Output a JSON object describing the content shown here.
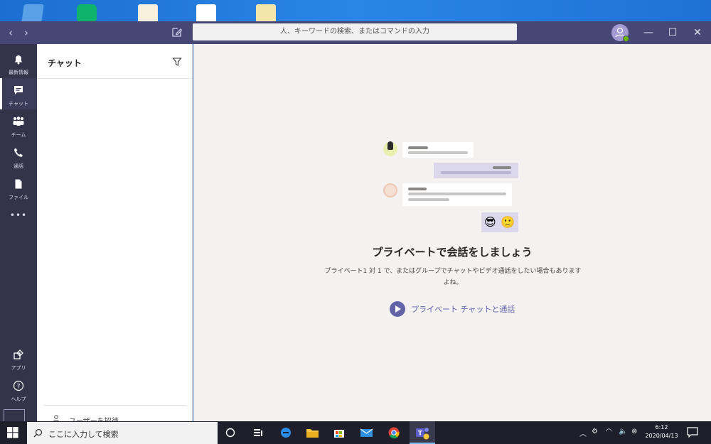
{
  "window": {
    "search_placeholder": "人、キーワードの検索、またはコマンドの入力",
    "controls": {
      "minimize": "—",
      "maximize": "☐",
      "close": "✕"
    }
  },
  "appbar": {
    "items": [
      {
        "label": "最新情報",
        "icon": "bell-icon"
      },
      {
        "label": "チャット",
        "icon": "chat-icon",
        "active": true
      },
      {
        "label": "チーム",
        "icon": "teams-icon"
      },
      {
        "label": "通話",
        "icon": "phone-icon"
      },
      {
        "label": "ファイル",
        "icon": "file-icon"
      },
      {
        "label": "•••",
        "icon": "more-icon"
      }
    ],
    "bottom": [
      {
        "label": "アプリ",
        "icon": "apps-icon"
      },
      {
        "label": "ヘルプ",
        "icon": "help-icon"
      }
    ]
  },
  "chat": {
    "title": "チャット",
    "footer_invite": "ユーザーを招待"
  },
  "main": {
    "headline": "プライベートで会話をしましょう",
    "subtext": "プライベート1 対 1 で、またはグループでチャットやビデオ通話をしたい場合もありますよね。",
    "cta": "プライベート チャットと通話",
    "emoji_cool": "😎",
    "emoji_smile": "🙂"
  },
  "taskbar": {
    "search_placeholder": "ここに入力して検索",
    "time": "6:12",
    "date": "2020/04/13"
  },
  "colors": {
    "teams_purple": "#6264a7",
    "titlebar": "#464775",
    "appbar": "#33344a",
    "main_bg": "#f3f2f1"
  }
}
